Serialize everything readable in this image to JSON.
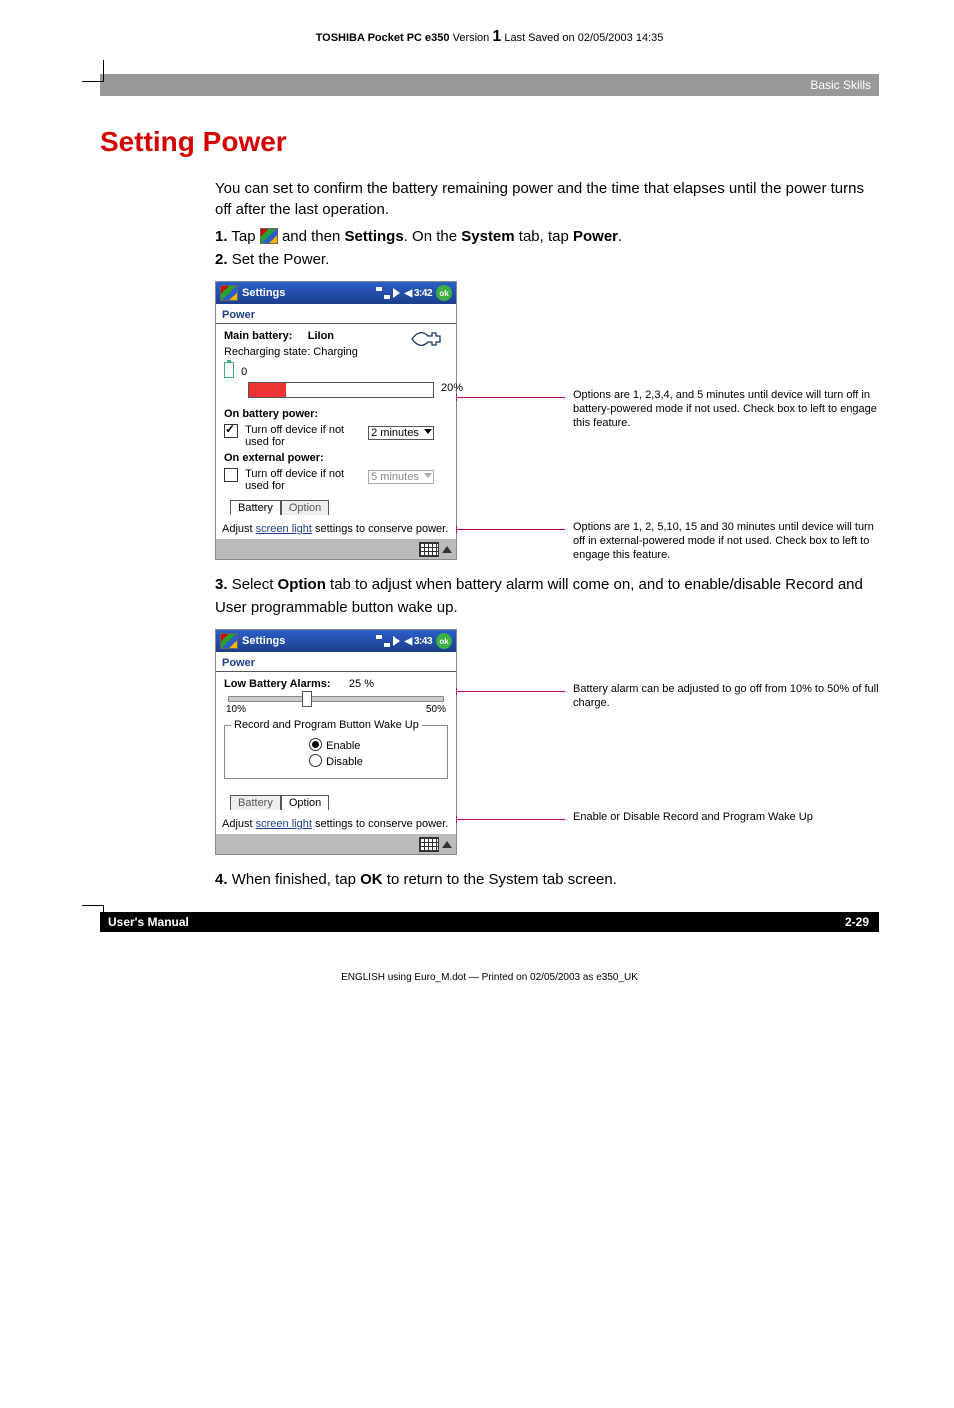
{
  "header": {
    "product": "TOSHIBA Pocket PC e350",
    "version_label": "Version",
    "version_num": "1",
    "saved": "Last Saved on 02/05/2003 14:35"
  },
  "breadcrumb": "Basic Skills",
  "title": "Setting Power",
  "intro": "You can set to confirm the battery remaining power and the time that elapses until the power turns off after the last operation.",
  "steps": {
    "s1_a": "1.",
    "s1_b": "Tap ",
    "s1_c": " and then ",
    "s1_d": "Settings",
    "s1_e": ". On the ",
    "s1_f": "System",
    "s1_g": " tab, tap ",
    "s1_h": "Power",
    "s1_i": ".",
    "s2_a": "2.",
    "s2_b": "Set the Power.",
    "s3_a": "3.",
    "s3_b": "Select ",
    "s3_c": "Option",
    "s3_d": " tab to adjust when battery alarm will come on, and to enable/disable Record and User programmable button wake up.",
    "s4_a": "4.",
    "s4_b": "When finished, tap ",
    "s4_c": "OK",
    "s4_d": " to return to the System tab screen."
  },
  "shot1": {
    "titlebar": {
      "title": "Settings",
      "time": "3:42",
      "ok": "ok"
    },
    "app": "Power",
    "main_label": "Main battery:",
    "main_val": "LiIon",
    "recharge": "Recharging state: Charging",
    "zero": "0",
    "pct": "20%",
    "onbatt": "On battery power:",
    "chk1": "Turn off device if not used for",
    "combo1": "2 minutes",
    "onext": "On external power:",
    "chk2": "Turn off device if not used for",
    "combo2": "5 minutes",
    "tab1": "Battery",
    "tab2": "Option",
    "linkline_a": "Adjust ",
    "linkline_b": "screen light",
    "linkline_c": " settings to conserve power."
  },
  "call1": {
    "a": "Options are 1, 2,3,4, and 5 minutes until device will turn off in battery-powered mode if not used. Check box to left to engage this feature.",
    "b": "Options are 1, 2, 5,10, 15 and 30 minutes until device will turn off in external-powered mode if not used. Check box to left to engage this feature."
  },
  "shot2": {
    "titlebar": {
      "title": "Settings",
      "time": "3:43",
      "ok": "ok"
    },
    "app": "Power",
    "low_label": "Low Battery Alarms:",
    "low_val": "25 %",
    "tick_lo": "10%",
    "tick_hi": "50%",
    "grp": "Record and Program Button Wake Up",
    "enable": "Enable",
    "disable": "Disable",
    "tab1": "Battery",
    "tab2": "Option",
    "linkline_a": "Adjust ",
    "linkline_b": "screen light",
    "linkline_c": " settings to conserve power."
  },
  "call2": {
    "a": "Battery alarm can be adjusted to go off from 10% to 50% of full charge.",
    "b": "Enable or Disable Record and Program Wake Up"
  },
  "footer": {
    "left": "User's Manual",
    "right": "2-29",
    "print": "ENGLISH using Euro_M.dot — Printed on 02/05/2003 as e350_UK"
  }
}
